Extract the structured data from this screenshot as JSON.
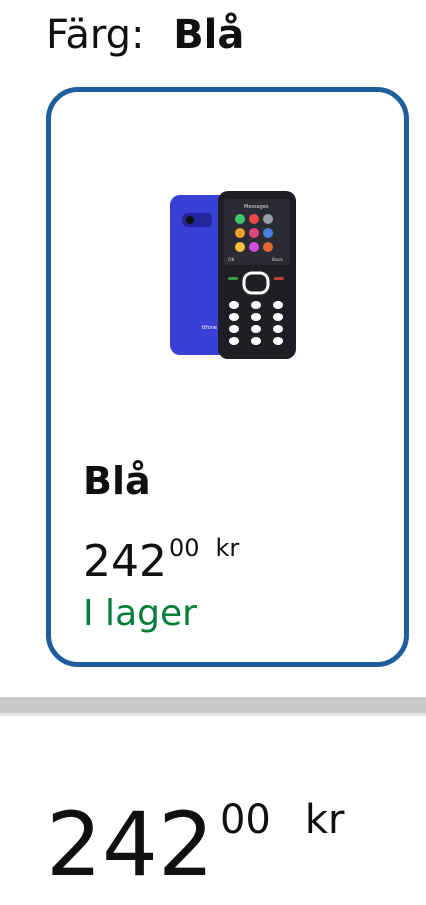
{
  "color_selector": {
    "label": "Färg:",
    "selected_value": "Blå"
  },
  "swatch": {
    "name": "Blå",
    "price_whole": "242",
    "price_fraction": "00",
    "price_currency": "kr",
    "availability": "I lager",
    "border_color": "#1f5e9c",
    "availability_color": "#067d3a",
    "phone_screen_title": "Messages",
    "phone_soft_left": "OK",
    "phone_soft_right": "Back",
    "phone_brand": "ttfone"
  },
  "price": {
    "whole": "242",
    "fraction": "00",
    "currency": "kr"
  }
}
